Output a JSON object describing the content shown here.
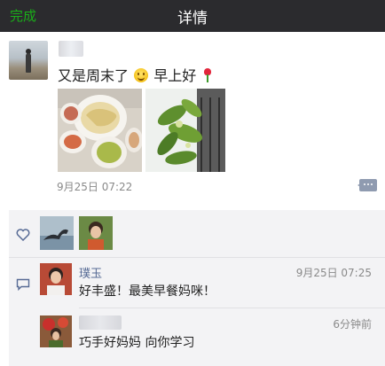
{
  "nav": {
    "done_label": "完成",
    "title": "详情"
  },
  "post": {
    "text_main": "又是周末了",
    "text_after_emoji": "早上好",
    "emoji": [
      "smile-emoji",
      "rose-emoji"
    ],
    "time": "9月25日 07:22"
  },
  "comments": [
    {
      "name": "璞玉",
      "text": "好丰盛！最美早餐妈咪！",
      "time": "9月25日 07:25"
    },
    {
      "name": "",
      "text": "巧手好妈妈 向你学习",
      "time": "6分钟前"
    }
  ],
  "colors": {
    "nav_bg": "#2b2b2e",
    "done_green": "#1aad19",
    "link_blue": "#576b95",
    "panel_bg": "#f3f3f5"
  }
}
